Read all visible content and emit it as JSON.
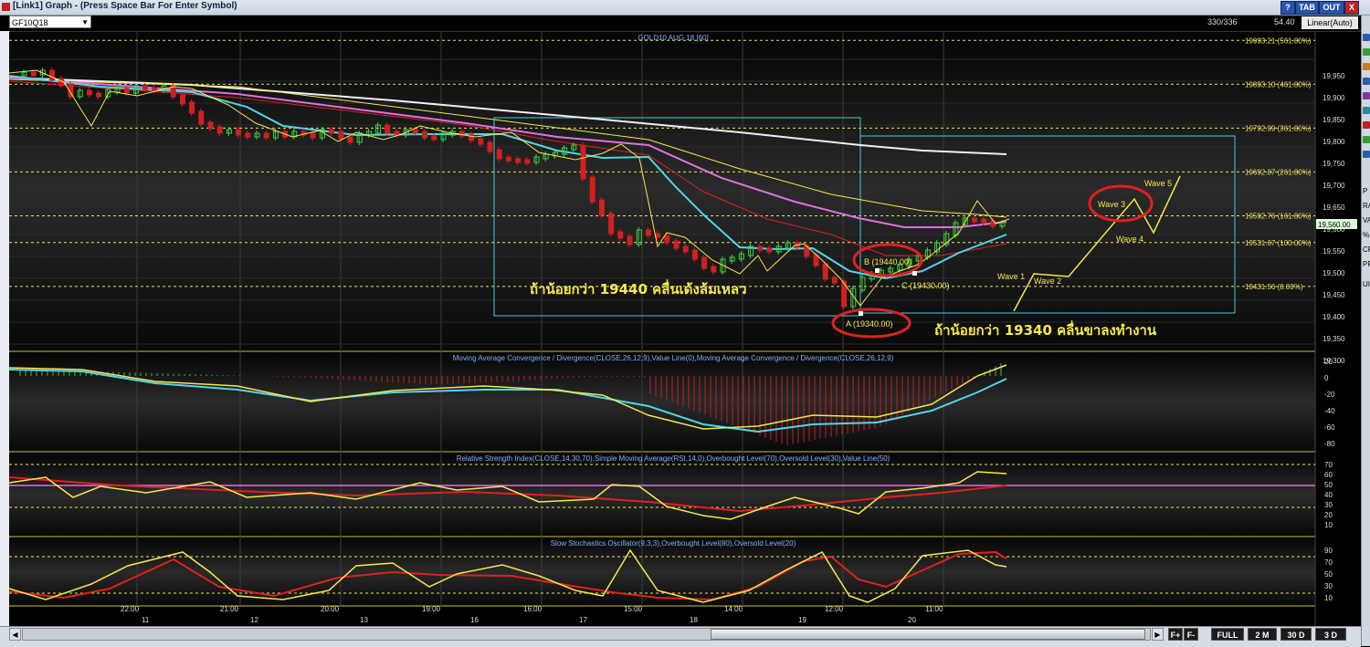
{
  "window": {
    "title": "[Link1] Graph  - (Press Space Bar For Enter Symbol)",
    "btn_help": "?",
    "btn_tab": "TAB",
    "btn_out": "OUT",
    "btn_close": "X"
  },
  "toolbar": {
    "symbol": "GF10Q18",
    "count": "330/336",
    "last": "54.40",
    "scale_mode": "Linear(Auto)"
  },
  "side_labels": [
    "P",
    "RA",
    "VA",
    "%",
    "CF",
    "PR",
    "UI"
  ],
  "main_chart": {
    "title": "GOLD10 AUG 18 [60]",
    "price_ticks": [
      "19,950",
      "19,900",
      "19,850",
      "19,800",
      "19,750",
      "19,700",
      "19,650",
      "19,600",
      "19,550",
      "19,500",
      "19,450",
      "19,400",
      "19,350",
      "19,300"
    ],
    "current_price": "19,560.00",
    "fib_levels": [
      {
        "value": 19993.21,
        "label": "19993.21 (561.80%)"
      },
      {
        "value": 19893.1,
        "label": "19893.10 (461.80%)"
      },
      {
        "value": 19792.99,
        "label": "19792.99 (361.80%)"
      },
      {
        "value": 19692.87,
        "label": "19692.87 (261.80%)"
      },
      {
        "value": 19592.76,
        "label": "19592.76 (161.80%)"
      },
      {
        "value": 19531.67,
        "label": "19531.67 (100.00%)"
      },
      {
        "value": 19431.56,
        "label": "19431.56 (0.00%)"
      }
    ],
    "points": {
      "a": "A (19340.00)",
      "b": "B (19440.00)",
      "c": "C (19430.00)"
    },
    "waves": [
      "Wave 1",
      "Wave 2",
      "Wave 3",
      "Wave 4",
      "Wave 5"
    ],
    "annotation_1": "ถ้าน้อยกว่า 19440 คลื่นเด้งล้มเหลว",
    "annotation_2": "ถ้าน้อยกว่า 19340 คลื่นขาลงทำงาน"
  },
  "macd": {
    "title": "Moving Average Convergence / Divergence(CLOSE,26,12,9),Value Line(0),Moving Average Convergence / Divergence(CLOSE,26,12,9)",
    "ticks": [
      "20",
      "0",
      "-20",
      "-40",
      "-60",
      "-80"
    ]
  },
  "rsi": {
    "title": "Relative Strength Index(CLOSE,14,30,70),Simple Moving Average(RSI,14,0),Overbought Level(70),Oversold Level(30),Value Line(50)",
    "ticks": [
      "70",
      "60",
      "50",
      "40",
      "30",
      "20",
      "10"
    ]
  },
  "stoch": {
    "title": "Slow Stochastics Oscillator(9,3,3),Overbought Level(80),Oversold Level(20)",
    "ticks": [
      "90",
      "70",
      "50",
      "30",
      "10"
    ]
  },
  "time_axis": {
    "hours": [
      "22:00",
      "21:00",
      "20:00",
      "19:00",
      "16:00",
      "15:00",
      "14:00",
      "12:00",
      "11:00"
    ],
    "days": [
      "11",
      "12",
      "13",
      "16",
      "17",
      "18",
      "19",
      "20"
    ]
  },
  "bottom_bar": {
    "full": "FULL",
    "m2": "2 M",
    "d30": "30 D",
    "d3": "3 D"
  },
  "colors": {
    "yellow": "#f5e84a",
    "cyan": "#4fd7e8",
    "magenta": "#e070e0",
    "red": "#e02020",
    "white": "#f0f0f0",
    "box": "#4fc7d8",
    "green_candle": "#3cd23c",
    "red_candle": "#d02020"
  }
}
